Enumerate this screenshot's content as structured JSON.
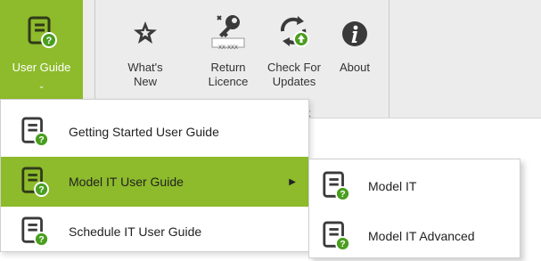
{
  "ribbon": {
    "buttons": [
      {
        "label": "User Guide",
        "icon": "user-guide-icon"
      },
      {
        "label": "What's\nNew",
        "icon": "star-icon"
      },
      {
        "label": "Return\nLicence",
        "icon": "key-icon",
        "key_tag": "XX-XXX"
      },
      {
        "label": "Check For\nUpdates",
        "icon": "update-icon"
      },
      {
        "label": "About",
        "icon": "info-icon"
      }
    ],
    "dropdown_arrow": "⌄",
    "group_label_partial": "t"
  },
  "menu": {
    "items": [
      {
        "label": "Getting Started User Guide"
      },
      {
        "label": "Model IT User Guide"
      },
      {
        "label": "Schedule IT User Guide"
      }
    ],
    "submenu_arrow": "▶"
  },
  "submenu": {
    "items": [
      {
        "label": "Model IT"
      },
      {
        "label": "Model IT Advanced"
      }
    ]
  },
  "colors": {
    "accent_green": "#8dbb2b",
    "icon_dark": "#3a3a3a",
    "badge_green": "#4a9e1f"
  }
}
